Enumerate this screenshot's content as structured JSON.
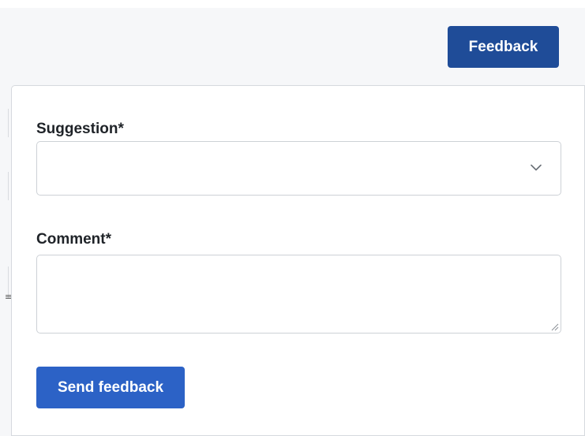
{
  "header": {
    "feedback_button_label": "Feedback"
  },
  "left_edge": {
    "glyph": "≡"
  },
  "form": {
    "suggestion": {
      "label": "Suggestion*",
      "selected_value": "",
      "icon": "chevron-down-icon"
    },
    "comment": {
      "label": "Comment*",
      "value": "",
      "placeholder": ""
    },
    "submit_label": "Send feedback"
  },
  "colors": {
    "primary_dark": "#1f4c98",
    "primary": "#2c62c6",
    "page_background": "#f6f7f9",
    "panel_background": "#ffffff",
    "border": "#cdd1d6"
  }
}
